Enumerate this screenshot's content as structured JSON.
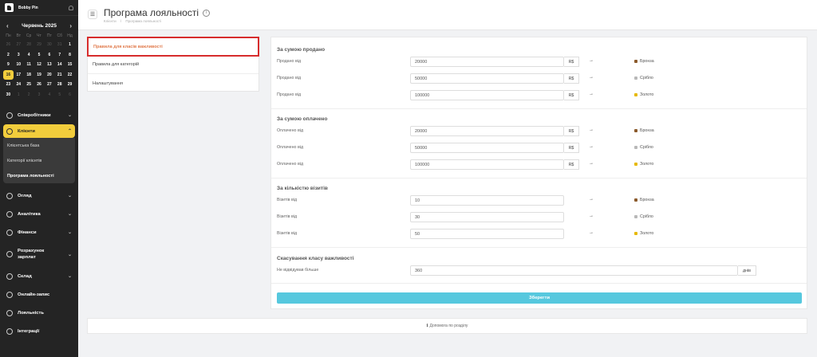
{
  "brand": {
    "name": "Bobby Pin"
  },
  "calendar": {
    "month": "Червень 2025",
    "weekdays": [
      "Пн",
      "Вт",
      "Ср",
      "Чт",
      "Пт",
      "Сб",
      "Нд"
    ],
    "days": [
      {
        "d": "26",
        "m": true
      },
      {
        "d": "27",
        "m": true
      },
      {
        "d": "28",
        "m": true
      },
      {
        "d": "29",
        "m": true
      },
      {
        "d": "30",
        "m": true
      },
      {
        "d": "31",
        "m": true
      },
      {
        "d": "1"
      },
      {
        "d": "2"
      },
      {
        "d": "3"
      },
      {
        "d": "4"
      },
      {
        "d": "5"
      },
      {
        "d": "6"
      },
      {
        "d": "7"
      },
      {
        "d": "8"
      },
      {
        "d": "9"
      },
      {
        "d": "10"
      },
      {
        "d": "11"
      },
      {
        "d": "12"
      },
      {
        "d": "13"
      },
      {
        "d": "14"
      },
      {
        "d": "15"
      },
      {
        "d": "16",
        "t": true
      },
      {
        "d": "17"
      },
      {
        "d": "18"
      },
      {
        "d": "19"
      },
      {
        "d": "20"
      },
      {
        "d": "21"
      },
      {
        "d": "22"
      },
      {
        "d": "23"
      },
      {
        "d": "24"
      },
      {
        "d": "25"
      },
      {
        "d": "26"
      },
      {
        "d": "27"
      },
      {
        "d": "28"
      },
      {
        "d": "29"
      },
      {
        "d": "30"
      },
      {
        "d": "1",
        "m": true
      },
      {
        "d": "2",
        "m": true
      },
      {
        "d": "3",
        "m": true
      },
      {
        "d": "4",
        "m": true
      },
      {
        "d": "5",
        "m": true
      },
      {
        "d": "6",
        "m": true
      }
    ]
  },
  "nav": {
    "employees": "Співробітники",
    "clients": "Клієнти",
    "clients_sub": [
      "Клієнтська база",
      "Категорії клієнтів",
      "Програма лояльності"
    ],
    "overview": "Огляд",
    "analytics": "Аналітика",
    "finance": "Фінанси",
    "payroll": "Розрахунок зарплат",
    "warehouse": "Склад",
    "online": "Онлайн-запис",
    "loyalty": "Лояльність",
    "integrations": "Інтеграції"
  },
  "header": {
    "title": "Програма лояльності",
    "breadcrumb_home": "Клієнти",
    "breadcrumb_sep": "/",
    "breadcrumb_current": "Програма лояльності"
  },
  "leftnav": [
    "Правила для класів важливості",
    "Правила для категорій",
    "Налаштування"
  ],
  "sections": {
    "sold": {
      "title": "За сумою продано",
      "rows": [
        {
          "label": "Продано від",
          "value": "20000",
          "unit": "R$",
          "level": "Бронза"
        },
        {
          "label": "Продано від",
          "value": "50000",
          "unit": "R$",
          "level": "Срібло"
        },
        {
          "label": "Продано від",
          "value": "100000",
          "unit": "R$",
          "level": "Золото"
        }
      ]
    },
    "paid": {
      "title": "За сумою оплачено",
      "rows": [
        {
          "label": "Оплачено від",
          "value": "20000",
          "unit": "R$",
          "level": "Бронза"
        },
        {
          "label": "Оплачено від",
          "value": "50000",
          "unit": "R$",
          "level": "Срібло"
        },
        {
          "label": "Оплачено від",
          "value": "100000",
          "unit": "R$",
          "level": "Золото"
        }
      ]
    },
    "visits": {
      "title": "За кількістю візитів",
      "rows": [
        {
          "label": "Візитів від",
          "value": "10",
          "level": "Бронза"
        },
        {
          "label": "Візитів від",
          "value": "30",
          "level": "Срібло"
        },
        {
          "label": "Візитів від",
          "value": "50",
          "level": "Золото"
        }
      ]
    },
    "cancel": {
      "title": "Скасування класу важливості",
      "label": "Не відвідував більше",
      "value": "360",
      "unit": "днів"
    }
  },
  "arrow": "→",
  "level_colors": {
    "bronze": "#8b5a2b",
    "silver": "#b8b8b8",
    "gold": "#e6b800"
  },
  "save_label": "Зберегти",
  "help_label": "Допомога по розділу"
}
